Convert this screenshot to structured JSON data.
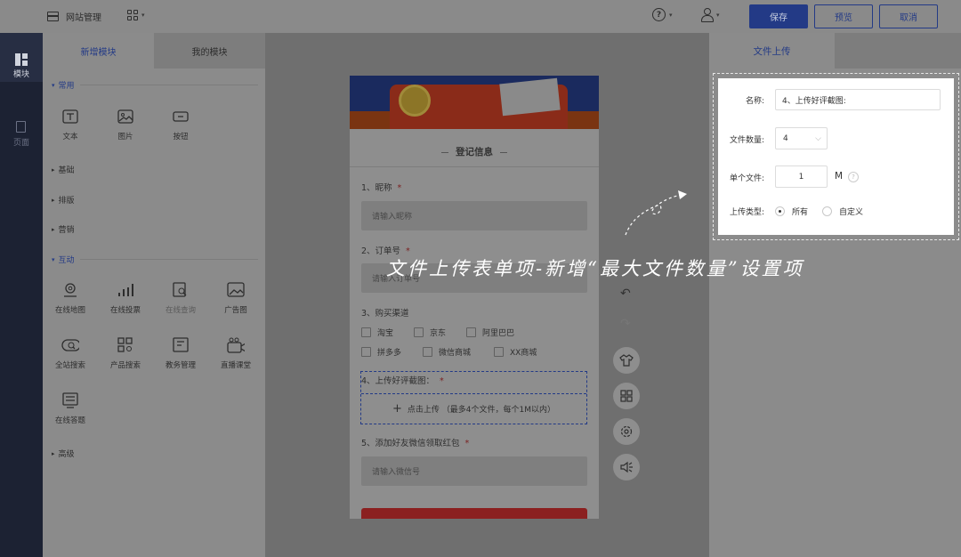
{
  "topbar": {
    "site_title": "网站管理",
    "save": "保存",
    "preview": "预览",
    "cancel": "取消",
    "colors": {
      "primary": "#233a86"
    }
  },
  "rail": {
    "items": [
      {
        "label": "模块",
        "icon": "module-icon",
        "active": true
      },
      {
        "label": "页面",
        "icon": "page-icon",
        "active": false
      }
    ]
  },
  "modules": {
    "tabs": [
      "新增模块",
      "我的模块"
    ],
    "sections": {
      "common": "常用",
      "basic": "基础",
      "layout": "排版",
      "marketing": "营销",
      "interactive": "互动",
      "advanced": "高级"
    },
    "common_tools": [
      "文本",
      "图片",
      "按钮"
    ],
    "interactive_tools": [
      "在线地图",
      "在线投票",
      "在线查询",
      "广告图",
      "全站搜索",
      "产品搜索",
      "教务管理",
      "直播课堂",
      "在线答题"
    ]
  },
  "form": {
    "title": "登记信息",
    "q1": {
      "label": "1、昵称",
      "placeholder": "请输入昵称"
    },
    "q2": {
      "label": "2、订单号",
      "placeholder": "请输入订单号"
    },
    "q3": {
      "label": "3、购买渠道",
      "options": [
        "淘宝",
        "京东",
        "阿里巴巴",
        "拼多多",
        "微信商城",
        "XX商城"
      ]
    },
    "q4": {
      "label": "4、上传好评截图：",
      "upload_text": "点击上传 （最多4个文件，每个1M以内）"
    },
    "q5": {
      "label": "5、添加好友微信领取红包",
      "placeholder": "请输入微信号"
    },
    "required_mark": "*"
  },
  "props": {
    "tab": "文件上传",
    "name_label": "名称:",
    "name_value": "4、上传好评截图:",
    "count_label": "文件数量:",
    "count_value": "4",
    "size_label": "单个文件:",
    "size_value": "1",
    "size_unit": "M",
    "type_label": "上传类型:",
    "type_all": "所有",
    "type_custom": "自定义"
  },
  "caption": "文件上传表单项-新增“最大文件数量”设置项"
}
